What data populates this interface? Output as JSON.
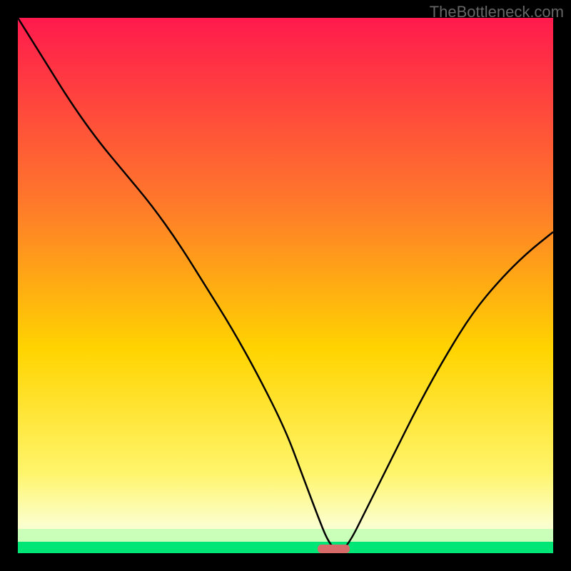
{
  "attribution": "TheBottleneck.com",
  "colors": {
    "bg": "#000000",
    "grad_top": "#ff1a4d",
    "grad_mid1": "#ff7a2a",
    "grad_mid2": "#ffd400",
    "grad_low": "#fff56b",
    "pale": "#fbffd0",
    "green": "#00e676",
    "marker": "#d96a6a",
    "curve": "#000000",
    "attribution_text": "#666666"
  },
  "chart_data": {
    "type": "line",
    "title": "",
    "xlabel": "",
    "ylabel": "",
    "xlim": [
      0,
      100
    ],
    "ylim": [
      0,
      100
    ],
    "series": [
      {
        "name": "bottleneck-curve",
        "x": [
          0,
          5,
          10,
          15,
          20,
          25,
          30,
          35,
          40,
          45,
          50,
          53,
          56,
          58,
          60,
          62,
          65,
          70,
          75,
          80,
          85,
          90,
          95,
          100
        ],
        "y": [
          100,
          92,
          84,
          77,
          71,
          65,
          58,
          50,
          42,
          33,
          23,
          15,
          7,
          2,
          0,
          2,
          8,
          18,
          28,
          37,
          45,
          51,
          56,
          60
        ]
      }
    ],
    "marker": {
      "x_start": 56,
      "x_end": 62,
      "y": 0
    }
  }
}
